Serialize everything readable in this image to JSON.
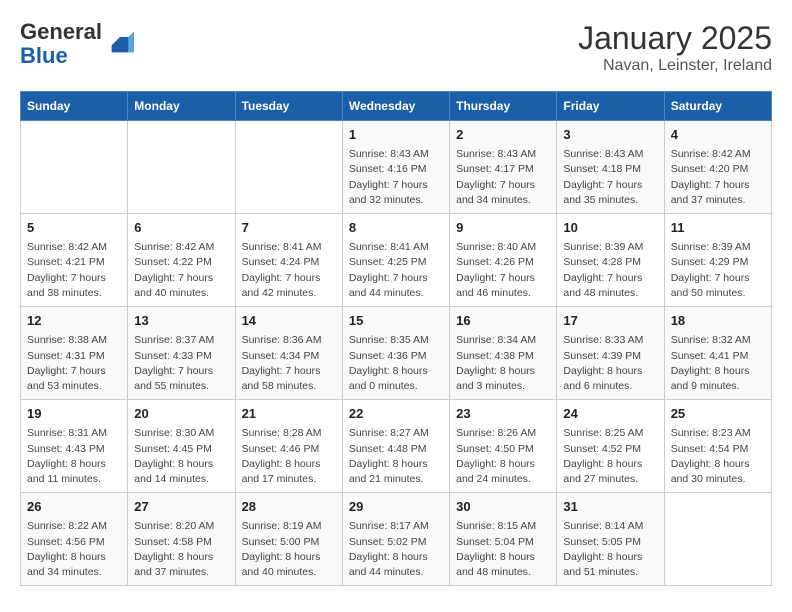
{
  "header": {
    "logo_line1": "General",
    "logo_line2": "Blue",
    "title": "January 2025",
    "subtitle": "Navan, Leinster, Ireland"
  },
  "weekdays": [
    "Sunday",
    "Monday",
    "Tuesday",
    "Wednesday",
    "Thursday",
    "Friday",
    "Saturday"
  ],
  "weeks": [
    [
      {
        "day": "",
        "info": ""
      },
      {
        "day": "",
        "info": ""
      },
      {
        "day": "",
        "info": ""
      },
      {
        "day": "1",
        "info": "Sunrise: 8:43 AM\nSunset: 4:16 PM\nDaylight: 7 hours\nand 32 minutes."
      },
      {
        "day": "2",
        "info": "Sunrise: 8:43 AM\nSunset: 4:17 PM\nDaylight: 7 hours\nand 34 minutes."
      },
      {
        "day": "3",
        "info": "Sunrise: 8:43 AM\nSunset: 4:18 PM\nDaylight: 7 hours\nand 35 minutes."
      },
      {
        "day": "4",
        "info": "Sunrise: 8:42 AM\nSunset: 4:20 PM\nDaylight: 7 hours\nand 37 minutes."
      }
    ],
    [
      {
        "day": "5",
        "info": "Sunrise: 8:42 AM\nSunset: 4:21 PM\nDaylight: 7 hours\nand 38 minutes."
      },
      {
        "day": "6",
        "info": "Sunrise: 8:42 AM\nSunset: 4:22 PM\nDaylight: 7 hours\nand 40 minutes."
      },
      {
        "day": "7",
        "info": "Sunrise: 8:41 AM\nSunset: 4:24 PM\nDaylight: 7 hours\nand 42 minutes."
      },
      {
        "day": "8",
        "info": "Sunrise: 8:41 AM\nSunset: 4:25 PM\nDaylight: 7 hours\nand 44 minutes."
      },
      {
        "day": "9",
        "info": "Sunrise: 8:40 AM\nSunset: 4:26 PM\nDaylight: 7 hours\nand 46 minutes."
      },
      {
        "day": "10",
        "info": "Sunrise: 8:39 AM\nSunset: 4:28 PM\nDaylight: 7 hours\nand 48 minutes."
      },
      {
        "day": "11",
        "info": "Sunrise: 8:39 AM\nSunset: 4:29 PM\nDaylight: 7 hours\nand 50 minutes."
      }
    ],
    [
      {
        "day": "12",
        "info": "Sunrise: 8:38 AM\nSunset: 4:31 PM\nDaylight: 7 hours\nand 53 minutes."
      },
      {
        "day": "13",
        "info": "Sunrise: 8:37 AM\nSunset: 4:33 PM\nDaylight: 7 hours\nand 55 minutes."
      },
      {
        "day": "14",
        "info": "Sunrise: 8:36 AM\nSunset: 4:34 PM\nDaylight: 7 hours\nand 58 minutes."
      },
      {
        "day": "15",
        "info": "Sunrise: 8:35 AM\nSunset: 4:36 PM\nDaylight: 8 hours\nand 0 minutes."
      },
      {
        "day": "16",
        "info": "Sunrise: 8:34 AM\nSunset: 4:38 PM\nDaylight: 8 hours\nand 3 minutes."
      },
      {
        "day": "17",
        "info": "Sunrise: 8:33 AM\nSunset: 4:39 PM\nDaylight: 8 hours\nand 6 minutes."
      },
      {
        "day": "18",
        "info": "Sunrise: 8:32 AM\nSunset: 4:41 PM\nDaylight: 8 hours\nand 9 minutes."
      }
    ],
    [
      {
        "day": "19",
        "info": "Sunrise: 8:31 AM\nSunset: 4:43 PM\nDaylight: 8 hours\nand 11 minutes."
      },
      {
        "day": "20",
        "info": "Sunrise: 8:30 AM\nSunset: 4:45 PM\nDaylight: 8 hours\nand 14 minutes."
      },
      {
        "day": "21",
        "info": "Sunrise: 8:28 AM\nSunset: 4:46 PM\nDaylight: 8 hours\nand 17 minutes."
      },
      {
        "day": "22",
        "info": "Sunrise: 8:27 AM\nSunset: 4:48 PM\nDaylight: 8 hours\nand 21 minutes."
      },
      {
        "day": "23",
        "info": "Sunrise: 8:26 AM\nSunset: 4:50 PM\nDaylight: 8 hours\nand 24 minutes."
      },
      {
        "day": "24",
        "info": "Sunrise: 8:25 AM\nSunset: 4:52 PM\nDaylight: 8 hours\nand 27 minutes."
      },
      {
        "day": "25",
        "info": "Sunrise: 8:23 AM\nSunset: 4:54 PM\nDaylight: 8 hours\nand 30 minutes."
      }
    ],
    [
      {
        "day": "26",
        "info": "Sunrise: 8:22 AM\nSunset: 4:56 PM\nDaylight: 8 hours\nand 34 minutes."
      },
      {
        "day": "27",
        "info": "Sunrise: 8:20 AM\nSunset: 4:58 PM\nDaylight: 8 hours\nand 37 minutes."
      },
      {
        "day": "28",
        "info": "Sunrise: 8:19 AM\nSunset: 5:00 PM\nDaylight: 8 hours\nand 40 minutes."
      },
      {
        "day": "29",
        "info": "Sunrise: 8:17 AM\nSunset: 5:02 PM\nDaylight: 8 hours\nand 44 minutes."
      },
      {
        "day": "30",
        "info": "Sunrise: 8:15 AM\nSunset: 5:04 PM\nDaylight: 8 hours\nand 48 minutes."
      },
      {
        "day": "31",
        "info": "Sunrise: 8:14 AM\nSunset: 5:05 PM\nDaylight: 8 hours\nand 51 minutes."
      },
      {
        "day": "",
        "info": ""
      }
    ]
  ]
}
